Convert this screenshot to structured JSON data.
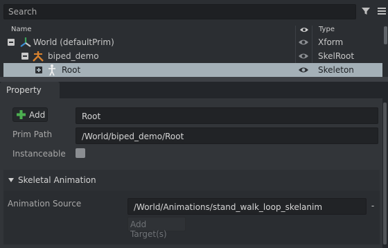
{
  "stage": {
    "search": {
      "placeholder": "Search",
      "value": ""
    },
    "columns": {
      "name": "Name",
      "type": "Type"
    },
    "rows": [
      {
        "label": "World (defaultPrim)",
        "type": "Xform",
        "icon": "xform-axes-icon",
        "expander": "minus"
      },
      {
        "label": "biped_demo",
        "type": "SkelRoot",
        "icon": "skelroot-icon",
        "expander": "minus"
      },
      {
        "label": "Root",
        "type": "Skeleton",
        "icon": "skeleton-figure-icon",
        "expander": "plus",
        "selected": true
      }
    ]
  },
  "property": {
    "tab": "Property",
    "add_label": "Add",
    "prim_name": "Root",
    "prim_path_label": "Prim Path",
    "prim_path": "/World/biped_demo/Root",
    "instanceable_label": "Instanceable",
    "instanceable": false,
    "skel_section": {
      "title": "Skeletal Animation",
      "anim_source_label": "Animation Source",
      "anim_source": "/World/Animations/stand_walk_loop_skelanim",
      "remove_label": "-",
      "add_targets_label": "Add Target(s)"
    }
  },
  "colors": {
    "selection": "#a4b0b7",
    "panel": "#323539",
    "field": "#212326",
    "xform_green": "#3ca35b",
    "skel_orange": "#d9822e",
    "add_green": "#4caf50"
  }
}
